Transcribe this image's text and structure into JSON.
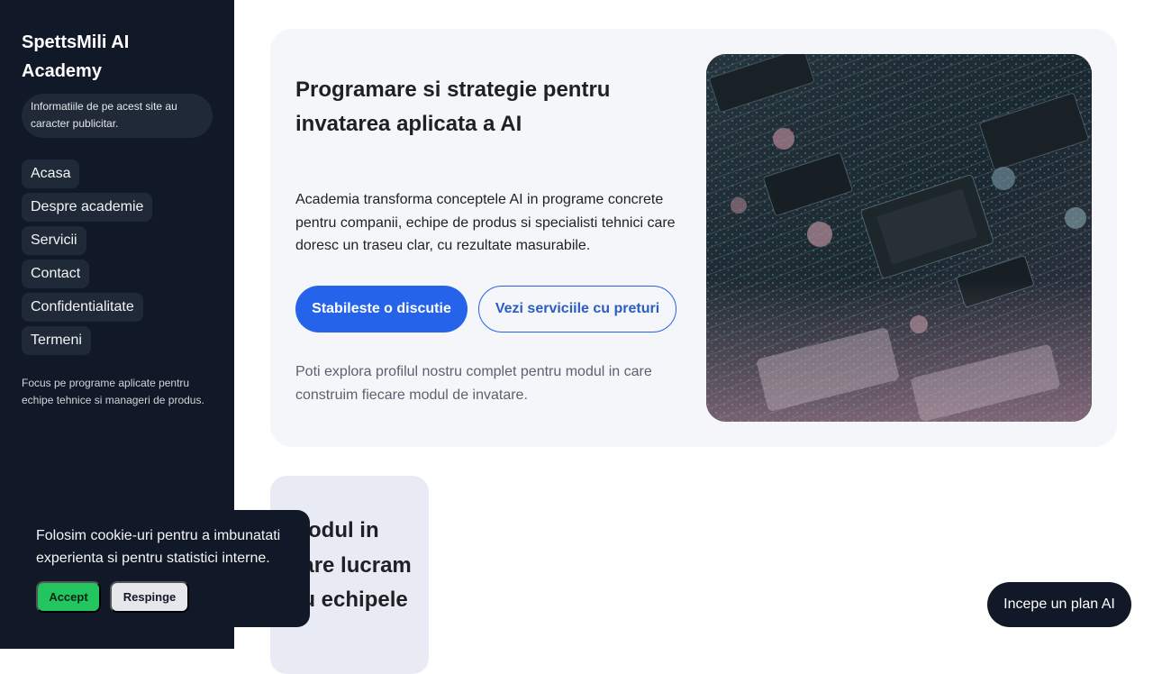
{
  "sidebar": {
    "brand": "SpettsMili AI Academy",
    "ad_notice": "Informatiile de pe acest site au caracter publicitar.",
    "nav": [
      {
        "label": "Acasa"
      },
      {
        "label": "Despre academie"
      },
      {
        "label": "Servicii"
      },
      {
        "label": "Contact"
      },
      {
        "label": "Confidentialitate"
      },
      {
        "label": "Termeni"
      }
    ],
    "note": "Focus pe programe aplicate pentru echipe tehnice si manageri de produs."
  },
  "hero": {
    "title": "Programare si strategie pentru invatarea aplicata a AI",
    "description": "Academia transforma conceptele AI in programe concrete pentru companii, echipe de produs si specialisti tehnici care doresc un traseu clar, cu rezultate masurabile.",
    "primary_button": "Stabileste o discutie",
    "secondary_button": "Vezi serviciile cu preturi",
    "note": "Poti explora profilul nostru complet pentru modul in care construim fiecare modul de invatare.",
    "image": "circuit-board-photo"
  },
  "second_card": {
    "title": "Modul in care lucram cu echipele"
  },
  "cookie_banner": {
    "text": "Folosim cookie-uri pentru a imbunatati experienta si pentru statistici interne.",
    "accept": "Accept",
    "reject": "Respinge"
  },
  "floating_cta": {
    "label": "Incepe un plan AI"
  },
  "colors": {
    "sidebar_bg": "#111827",
    "accent": "#2563eb",
    "accept_green": "#22c55e",
    "hero_bg": "#f4f6fa"
  }
}
